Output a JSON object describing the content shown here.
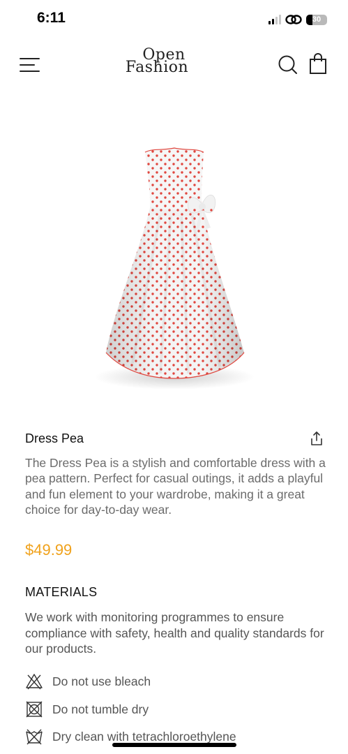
{
  "status_bar": {
    "time": "6:11",
    "battery": "30"
  },
  "header": {
    "logo_line1": "Open",
    "logo_line2": "Fashion"
  },
  "product": {
    "name": "Dress Pea",
    "description": "The Dress Pea is a stylish and comfortable dress with a pea pattern. Perfect for casual outings, it adds a playful and fun element to your wardrobe, making it a great choice for day-to-day wear.",
    "price": "$49.99",
    "price_color": "#f0a21c",
    "dot_color": "#e0473f"
  },
  "materials": {
    "heading": "MATERIALS",
    "description": "We work with monitoring programmes to ensure compliance with safety, health and quality standards for our products."
  },
  "care": [
    {
      "icon": "no-bleach-icon",
      "label": "Do not use bleach"
    },
    {
      "icon": "no-tumble-dry-icon",
      "label": "Do not tumble dry"
    },
    {
      "icon": "dry-clean-icon",
      "label": "Dry clean with tetrachloroethylene"
    }
  ]
}
